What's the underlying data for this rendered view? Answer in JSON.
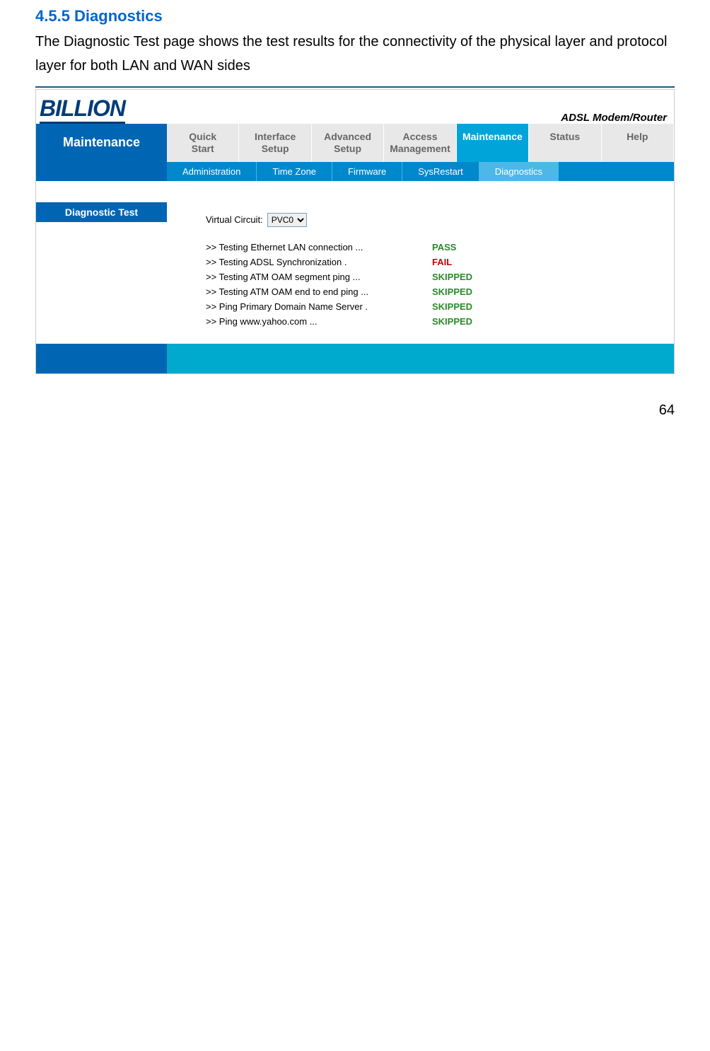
{
  "section": {
    "number": "4.5.5",
    "title": "Diagnostics",
    "heading": "4.5.5 Diagnostics",
    "description": "The Diagnostic Test page shows the test results for the connectivity of the physical layer and protocol layer for both LAN and WAN sides"
  },
  "ui": {
    "logo_text": "BILLION",
    "modem_label": "ADSL Modem/Router",
    "current_section": "Maintenance",
    "nav_tabs": [
      "Quick\nStart",
      "Interface\nSetup",
      "Advanced\nSetup",
      "Access\nManagement",
      "Maintenance",
      "Status",
      "Help"
    ],
    "subnav_tabs": [
      "Administration",
      "Time Zone",
      "Firmware",
      "SysRestart",
      "Diagnostics"
    ],
    "panel_title": "Diagnostic Test",
    "vc_label": "Virtual Circuit:",
    "vc_value": "PVC0",
    "diag_rows": [
      {
        "label": ">> Testing Ethernet LAN connection ...",
        "result": "PASS",
        "cls": "pass"
      },
      {
        "label": ">> Testing ADSL Synchronization .",
        "result": "FAIL",
        "cls": "fail"
      },
      {
        "label": ">> Testing ATM OAM segment ping ...",
        "result": "SKIPPED",
        "cls": "skipped"
      },
      {
        "label": ">> Testing ATM OAM end to end ping ...",
        "result": "SKIPPED",
        "cls": "skipped"
      },
      {
        "label": ">> Ping Primary Domain Name Server .",
        "result": "SKIPPED",
        "cls": "skipped"
      },
      {
        "label": ">> Ping www.yahoo.com ...",
        "result": "SKIPPED",
        "cls": "skipped"
      }
    ]
  },
  "page_number": "64"
}
